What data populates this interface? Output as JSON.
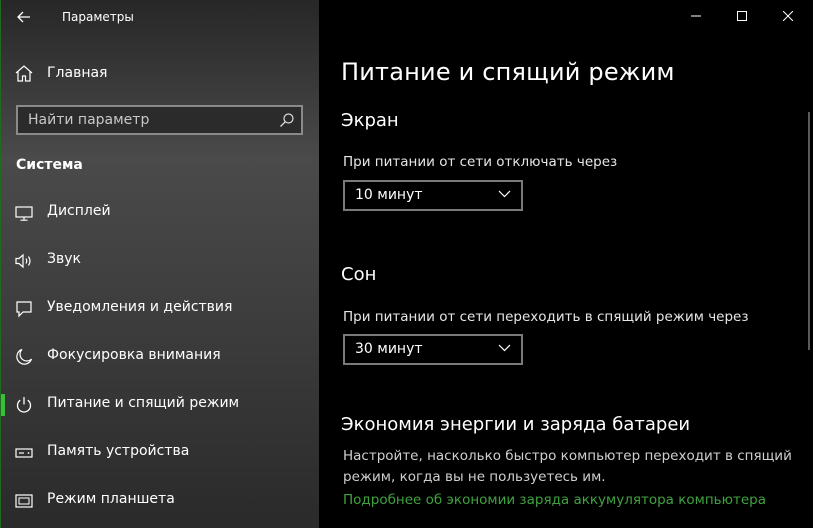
{
  "app": {
    "title": "Параметры"
  },
  "sidebar": {
    "home_label": "Главная",
    "search_placeholder": "Найти параметр",
    "section": "Система",
    "items": [
      {
        "label": "Дисплей",
        "icon": "monitor-icon"
      },
      {
        "label": "Звук",
        "icon": "speaker-icon"
      },
      {
        "label": "Уведомления и действия",
        "icon": "notification-icon"
      },
      {
        "label": "Фокусировка внимания",
        "icon": "moon-icon"
      },
      {
        "label": "Питание и спящий режим",
        "icon": "power-icon",
        "selected": true
      },
      {
        "label": "Память устройства",
        "icon": "storage-icon"
      },
      {
        "label": "Режим планшета",
        "icon": "tablet-icon"
      }
    ]
  },
  "main": {
    "title": "Питание и спящий режим",
    "screen": {
      "heading": "Экран",
      "label": "При питании от сети отключать через",
      "value": "10 минут"
    },
    "sleep": {
      "heading": "Сон",
      "label": "При питании от сети переходить в спящий режим через",
      "value": "30 минут"
    },
    "saver": {
      "heading": "Экономия энергии и заряда батареи",
      "line1": "Настройте, насколько быстро компьютер переходит в спящий",
      "line2": "режим, когда вы не пользуетесь им.",
      "link": "Подробнее об экономии заряда аккумулятора компьютера"
    }
  },
  "colors": {
    "accent": "#3bbf3b",
    "link": "#3fa23f",
    "background": "#000000"
  }
}
